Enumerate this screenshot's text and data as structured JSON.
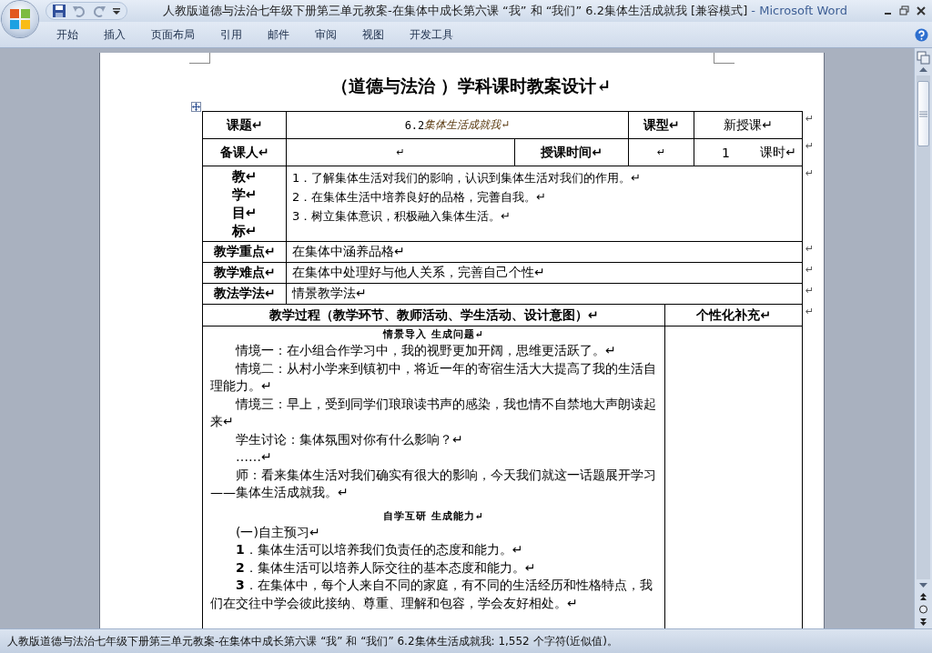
{
  "window": {
    "title": "人教版道德与法治七年级下册第三单元教案-在集体中成长第六课 “我” 和 “我们” 6.2集体生活成就我 [兼容模式]",
    "app": "- Microsoft Word"
  },
  "ribbon_tabs": [
    {
      "label": "开始"
    },
    {
      "label": "插入"
    },
    {
      "label": "页面布局"
    },
    {
      "label": "引用"
    },
    {
      "label": "邮件"
    },
    {
      "label": "审阅"
    },
    {
      "label": "视图"
    },
    {
      "label": "开发工具"
    }
  ],
  "document": {
    "heading": "（道德与法治 ）学科课时教案设计↵",
    "table": {
      "lesson": {
        "label": "课题↵",
        "number": "6.2",
        "topic": "集体生活成就我↵",
        "type_label": "课型↵",
        "type_value": "新授课↵",
        "end_mark": "↵"
      },
      "prep": {
        "label": "备课人↵",
        "preparer": "↵",
        "time_label": "授课时间↵",
        "time_value": "↵",
        "hours": "1",
        "hours_unit": "课时↵",
        "end_mark": "↵"
      },
      "objectives": {
        "label_chars": [
          "教↵",
          "学↵",
          "目↵",
          "标↵"
        ],
        "items": [
          "1．了解集体生活对我们的影响，认识到集体生活对我们的作用。↵",
          "2．在集体生活中培养良好的品格，完善自我。↵",
          "3．树立集体意识，积极融入集体生活。↵"
        ],
        "end_mark": "↵"
      },
      "key_rows": [
        {
          "label": "教学重点↵",
          "value": "在集体中涵养品格↵",
          "end_mark": "↵"
        },
        {
          "label": "教学难点↵",
          "value": "在集体中处理好与他人关系，完善自己个性↵",
          "end_mark": "↵"
        },
        {
          "label": "教法学法↵",
          "value": "情景教学法↵",
          "end_mark": "↵"
        }
      ],
      "process": {
        "header": "教学过程（教学环节、教师活动、学生活动、设计意图）↵",
        "side_header": "个性化补充↵",
        "end_mark": "↵",
        "blocks": [
          {
            "kind": "section",
            "text": "情景导入 生成问题↵"
          },
          {
            "kind": "para",
            "text": "情境一：在小组合作学习中，我的视野更加开阔，思维更活跃了。↵"
          },
          {
            "kind": "para",
            "text": "情境二：从村小学来到镇初中，将近一年的寄宿生活大大提高了我的生活自理能力。↵"
          },
          {
            "kind": "para",
            "text": "情境三：早上，受到同学们琅琅读书声的感染，我也情不自禁地大声朗读起来↵"
          },
          {
            "kind": "para",
            "text": "学生讨论：集体氛围对你有什么影响？↵"
          },
          {
            "kind": "para",
            "text": "……↵"
          },
          {
            "kind": "para",
            "text": "师：看来集体生活对我们确实有很大的影响，今天我们就这一话题展开学习——集体生活成就我。↵"
          },
          {
            "kind": "gap"
          },
          {
            "kind": "section",
            "text": "自学互研 生成能力↵"
          },
          {
            "kind": "para",
            "text": "(一)自主预习↵"
          },
          {
            "kind": "para",
            "text": "**1**．集体生活可以培养我们负责任的态度和能力。↵"
          },
          {
            "kind": "para",
            "text": "**2**．集体生活可以培养人际交往的基本态度和能力。↵"
          },
          {
            "kind": "para",
            "text": "**3**．在集体中，每个人来自不同的家庭，有不同的生活经历和性格特点，我们在交往中学会彼此接纳、尊重、理解和包容，学会友好相处。↵"
          }
        ]
      }
    }
  },
  "status_bar": "人教版道德与法治七年级下册第三单元教案-在集体中成长第六课 “我” 和 “我们” 6.2集体生活成就我: 1,552 个字符(近似值)。"
}
